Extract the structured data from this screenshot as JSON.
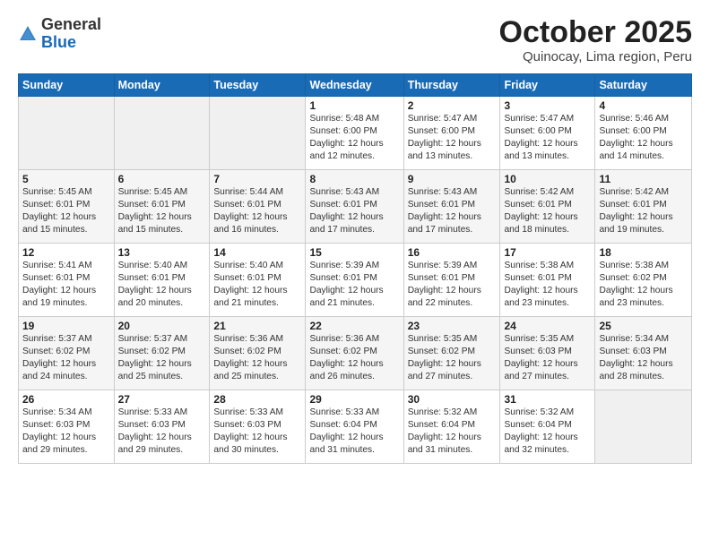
{
  "header": {
    "logo_general": "General",
    "logo_blue": "Blue",
    "month_title": "October 2025",
    "location": "Quinocay, Lima region, Peru"
  },
  "days_of_week": [
    "Sunday",
    "Monday",
    "Tuesday",
    "Wednesday",
    "Thursday",
    "Friday",
    "Saturday"
  ],
  "weeks": [
    [
      {
        "day": "",
        "info": ""
      },
      {
        "day": "",
        "info": ""
      },
      {
        "day": "",
        "info": ""
      },
      {
        "day": "1",
        "info": "Sunrise: 5:48 AM\nSunset: 6:00 PM\nDaylight: 12 hours\nand 12 minutes."
      },
      {
        "day": "2",
        "info": "Sunrise: 5:47 AM\nSunset: 6:00 PM\nDaylight: 12 hours\nand 13 minutes."
      },
      {
        "day": "3",
        "info": "Sunrise: 5:47 AM\nSunset: 6:00 PM\nDaylight: 12 hours\nand 13 minutes."
      },
      {
        "day": "4",
        "info": "Sunrise: 5:46 AM\nSunset: 6:00 PM\nDaylight: 12 hours\nand 14 minutes."
      }
    ],
    [
      {
        "day": "5",
        "info": "Sunrise: 5:45 AM\nSunset: 6:01 PM\nDaylight: 12 hours\nand 15 minutes."
      },
      {
        "day": "6",
        "info": "Sunrise: 5:45 AM\nSunset: 6:01 PM\nDaylight: 12 hours\nand 15 minutes."
      },
      {
        "day": "7",
        "info": "Sunrise: 5:44 AM\nSunset: 6:01 PM\nDaylight: 12 hours\nand 16 minutes."
      },
      {
        "day": "8",
        "info": "Sunrise: 5:43 AM\nSunset: 6:01 PM\nDaylight: 12 hours\nand 17 minutes."
      },
      {
        "day": "9",
        "info": "Sunrise: 5:43 AM\nSunset: 6:01 PM\nDaylight: 12 hours\nand 17 minutes."
      },
      {
        "day": "10",
        "info": "Sunrise: 5:42 AM\nSunset: 6:01 PM\nDaylight: 12 hours\nand 18 minutes."
      },
      {
        "day": "11",
        "info": "Sunrise: 5:42 AM\nSunset: 6:01 PM\nDaylight: 12 hours\nand 19 minutes."
      }
    ],
    [
      {
        "day": "12",
        "info": "Sunrise: 5:41 AM\nSunset: 6:01 PM\nDaylight: 12 hours\nand 19 minutes."
      },
      {
        "day": "13",
        "info": "Sunrise: 5:40 AM\nSunset: 6:01 PM\nDaylight: 12 hours\nand 20 minutes."
      },
      {
        "day": "14",
        "info": "Sunrise: 5:40 AM\nSunset: 6:01 PM\nDaylight: 12 hours\nand 21 minutes."
      },
      {
        "day": "15",
        "info": "Sunrise: 5:39 AM\nSunset: 6:01 PM\nDaylight: 12 hours\nand 21 minutes."
      },
      {
        "day": "16",
        "info": "Sunrise: 5:39 AM\nSunset: 6:01 PM\nDaylight: 12 hours\nand 22 minutes."
      },
      {
        "day": "17",
        "info": "Sunrise: 5:38 AM\nSunset: 6:01 PM\nDaylight: 12 hours\nand 23 minutes."
      },
      {
        "day": "18",
        "info": "Sunrise: 5:38 AM\nSunset: 6:02 PM\nDaylight: 12 hours\nand 23 minutes."
      }
    ],
    [
      {
        "day": "19",
        "info": "Sunrise: 5:37 AM\nSunset: 6:02 PM\nDaylight: 12 hours\nand 24 minutes."
      },
      {
        "day": "20",
        "info": "Sunrise: 5:37 AM\nSunset: 6:02 PM\nDaylight: 12 hours\nand 25 minutes."
      },
      {
        "day": "21",
        "info": "Sunrise: 5:36 AM\nSunset: 6:02 PM\nDaylight: 12 hours\nand 25 minutes."
      },
      {
        "day": "22",
        "info": "Sunrise: 5:36 AM\nSunset: 6:02 PM\nDaylight: 12 hours\nand 26 minutes."
      },
      {
        "day": "23",
        "info": "Sunrise: 5:35 AM\nSunset: 6:02 PM\nDaylight: 12 hours\nand 27 minutes."
      },
      {
        "day": "24",
        "info": "Sunrise: 5:35 AM\nSunset: 6:03 PM\nDaylight: 12 hours\nand 27 minutes."
      },
      {
        "day": "25",
        "info": "Sunrise: 5:34 AM\nSunset: 6:03 PM\nDaylight: 12 hours\nand 28 minutes."
      }
    ],
    [
      {
        "day": "26",
        "info": "Sunrise: 5:34 AM\nSunset: 6:03 PM\nDaylight: 12 hours\nand 29 minutes."
      },
      {
        "day": "27",
        "info": "Sunrise: 5:33 AM\nSunset: 6:03 PM\nDaylight: 12 hours\nand 29 minutes."
      },
      {
        "day": "28",
        "info": "Sunrise: 5:33 AM\nSunset: 6:03 PM\nDaylight: 12 hours\nand 30 minutes."
      },
      {
        "day": "29",
        "info": "Sunrise: 5:33 AM\nSunset: 6:04 PM\nDaylight: 12 hours\nand 31 minutes."
      },
      {
        "day": "30",
        "info": "Sunrise: 5:32 AM\nSunset: 6:04 PM\nDaylight: 12 hours\nand 31 minutes."
      },
      {
        "day": "31",
        "info": "Sunrise: 5:32 AM\nSunset: 6:04 PM\nDaylight: 12 hours\nand 32 minutes."
      },
      {
        "day": "",
        "info": ""
      }
    ]
  ]
}
